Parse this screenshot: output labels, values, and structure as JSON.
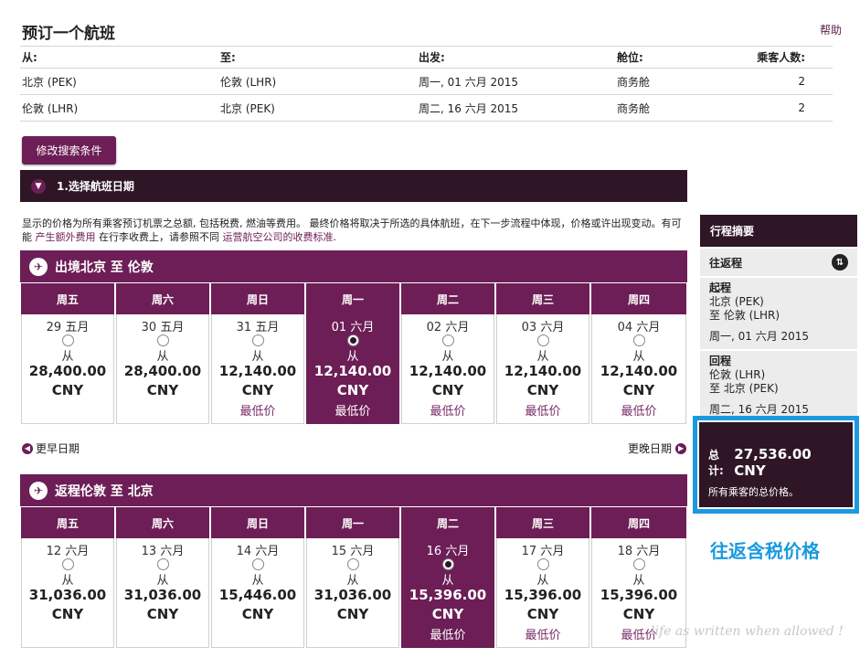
{
  "page": {
    "title": "预订一个航班",
    "help": "帮助"
  },
  "search": {
    "headers": [
      "从:",
      "至:",
      "出发:",
      "舱位:",
      "乘客人数:"
    ],
    "rows": [
      [
        "北京 (PEK)",
        "伦敦 (LHR)",
        "周一, 01 六月 2015",
        "商务舱",
        "2"
      ],
      [
        "伦敦 (LHR)",
        "北京 (PEK)",
        "周二, 16 六月 2015",
        "商务舱",
        "2"
      ]
    ],
    "modify_label": "修改搜索条件"
  },
  "section": {
    "title": "1.选择航班日期"
  },
  "notice": {
    "part1": "显示的价格为所有乘客预订机票之总额, 包括税费, 燃油等费用。 最终价格将取决于所选的具体航班，在下一步流程中体现，价格或许出现变动。有可能 ",
    "link1": "产生额外费用",
    "part2": " 在行李收费上，请参照不同 ",
    "link2": "运营航空公司的收费标准",
    "part3": "."
  },
  "outbound": {
    "title": "出境北京 至 伦敦",
    "days": [
      {
        "dow": "周五",
        "date": "29 五月",
        "from": "从",
        "price": "28,400.00",
        "cur": "CNY",
        "low": "",
        "selected": false
      },
      {
        "dow": "周六",
        "date": "30 五月",
        "from": "从",
        "price": "28,400.00",
        "cur": "CNY",
        "low": "",
        "selected": false
      },
      {
        "dow": "周日",
        "date": "31 五月",
        "from": "从",
        "price": "12,140.00",
        "cur": "CNY",
        "low": "最低价",
        "selected": false
      },
      {
        "dow": "周一",
        "date": "01 六月",
        "from": "从",
        "price": "12,140.00",
        "cur": "CNY",
        "low": "最低价",
        "selected": true
      },
      {
        "dow": "周二",
        "date": "02 六月",
        "from": "从",
        "price": "12,140.00",
        "cur": "CNY",
        "low": "最低价",
        "selected": false
      },
      {
        "dow": "周三",
        "date": "03 六月",
        "from": "从",
        "price": "12,140.00",
        "cur": "CNY",
        "low": "最低价",
        "selected": false
      },
      {
        "dow": "周四",
        "date": "04 六月",
        "from": "从",
        "price": "12,140.00",
        "cur": "CNY",
        "low": "最低价",
        "selected": false
      }
    ]
  },
  "nav": {
    "earlier": "更早日期",
    "later": "更晚日期"
  },
  "inbound": {
    "title": "返程伦敦 至 北京",
    "days": [
      {
        "dow": "周五",
        "date": "12 六月",
        "from": "从",
        "price": "31,036.00",
        "cur": "CNY",
        "low": "",
        "selected": false
      },
      {
        "dow": "周六",
        "date": "13 六月",
        "from": "从",
        "price": "31,036.00",
        "cur": "CNY",
        "low": "",
        "selected": false
      },
      {
        "dow": "周日",
        "date": "14 六月",
        "from": "从",
        "price": "15,446.00",
        "cur": "CNY",
        "low": "",
        "selected": false
      },
      {
        "dow": "周一",
        "date": "15 六月",
        "from": "从",
        "price": "31,036.00",
        "cur": "CNY",
        "low": "",
        "selected": false
      },
      {
        "dow": "周二",
        "date": "16 六月",
        "from": "从",
        "price": "15,396.00",
        "cur": "CNY",
        "low": "最低价",
        "selected": true
      },
      {
        "dow": "周三",
        "date": "17 六月",
        "from": "从",
        "price": "15,396.00",
        "cur": "CNY",
        "low": "最低价",
        "selected": false
      },
      {
        "dow": "周四",
        "date": "18 六月",
        "from": "从",
        "price": "15,396.00",
        "cur": "CNY",
        "low": "最低价",
        "selected": false
      }
    ]
  },
  "summary": {
    "title": "行程摘要",
    "trip_type": "往返程",
    "legs": [
      {
        "label": "起程",
        "from": "北京 (PEK)",
        "to": "至 伦敦 (LHR)",
        "date": "周一, 01 六月 2015"
      },
      {
        "label": "回程",
        "from": "伦敦 (LHR)",
        "to": "至 北京 (PEK)",
        "date": "周二, 16 六月 2015"
      }
    ],
    "total_label": "总计:",
    "total_value": "27,536.00 CNY",
    "total_note": "所有乘客的总价格。"
  },
  "annotation": "往返含税价格",
  "watermark": "life as written when allowed !",
  "colors": {
    "brand": "#6d1e56",
    "dark": "#2f1627",
    "highlight": "#1a9ae0"
  }
}
